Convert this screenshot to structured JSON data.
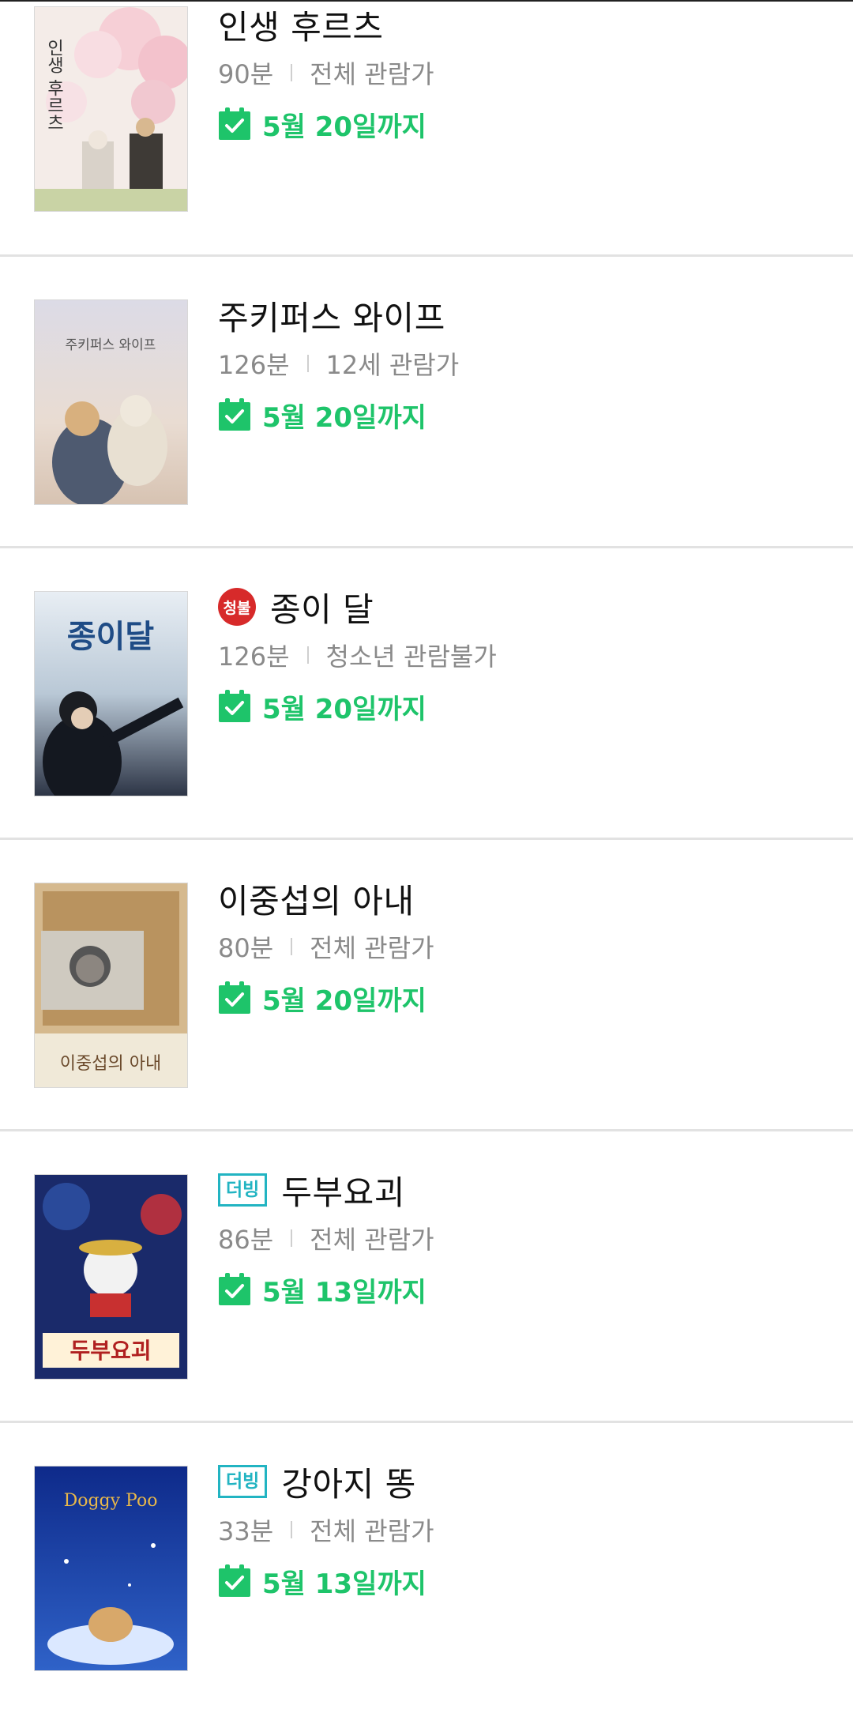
{
  "movies": [
    {
      "title": "인생 후르츠",
      "runtime": "90분",
      "rating": "전체 관람가",
      "until": "5월 20일까지",
      "badge": ""
    },
    {
      "title": "주키퍼스 와이프",
      "runtime": "126분",
      "rating": "12세 관람가",
      "until": "5월 20일까지",
      "badge": ""
    },
    {
      "title": "종이 달",
      "runtime": "126분",
      "rating": "청소년 관람불가",
      "until": "5월 20일까지",
      "badge": "청불"
    },
    {
      "title": "이중섭의 아내",
      "runtime": "80분",
      "rating": "전체 관람가",
      "until": "5월 20일까지",
      "badge": ""
    },
    {
      "title": "두부요괴",
      "runtime": "86분",
      "rating": "전체 관람가",
      "until": "5월 13일까지",
      "badge": "더빙"
    },
    {
      "title": "강아지 똥",
      "runtime": "33분",
      "rating": "전체 관람가",
      "until": "5월 13일까지",
      "badge": "더빙"
    }
  ],
  "poster_texts": {
    "poster_1_title": "인생 후르츠",
    "poster_2_title": "주키퍼스 와이프",
    "poster_3_title": "종이달",
    "poster_4_title": "이중섭의 아내",
    "poster_5_title": "두부요괴",
    "poster_6_title": "Doggy Poo"
  },
  "colors": {
    "accent_green": "#1ec46a",
    "adult_badge": "#d72a2a",
    "dub_badge": "#22b4c2",
    "meta_gray": "#8a8a8a"
  },
  "icons": {
    "calendar": "calendar-check-icon"
  }
}
